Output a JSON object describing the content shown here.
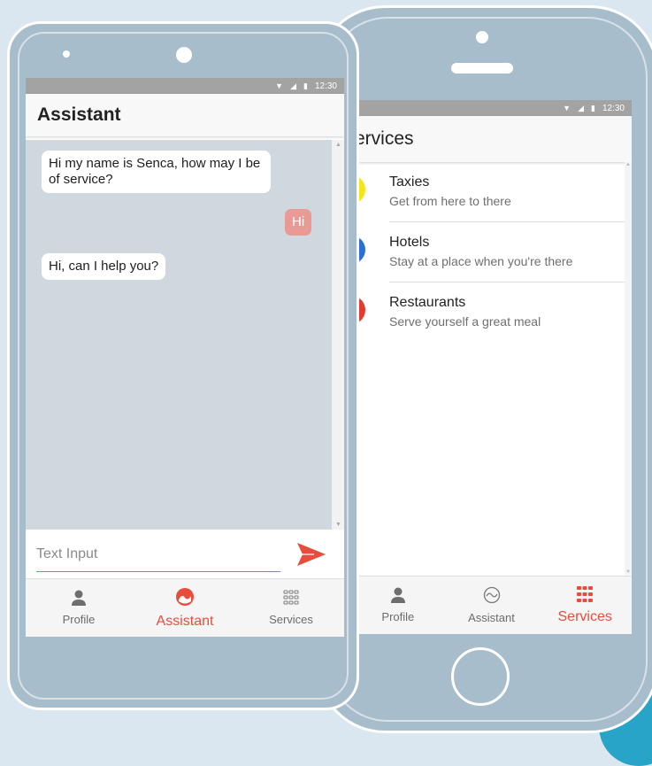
{
  "colors": {
    "accent": "#e84c3d",
    "chat_background": "#d0d8df",
    "user_bubble": "#ea9a94",
    "taxi_icon": "#f5e518",
    "hotel_icon": "#2c6fd6",
    "restaurant_icon": "#e33b2e"
  },
  "status_bar": {
    "time": "12:30"
  },
  "assistant_screen": {
    "title": "Assistant",
    "messages": [
      {
        "from": "bot",
        "text": "Hi my name is Senca, how may I be of service?"
      },
      {
        "from": "user",
        "text": "Hi"
      },
      {
        "from": "bot",
        "text": "Hi, can I help you?"
      }
    ],
    "input": {
      "placeholder": "Text Input",
      "value": ""
    },
    "send_icon": "send-arrow-icon",
    "nav": [
      {
        "label": "Profile",
        "icon": "person-icon",
        "active": false
      },
      {
        "label": "Assistant",
        "icon": "assistant-icon",
        "active": true
      },
      {
        "label": "Services",
        "icon": "grid-icon",
        "active": false
      }
    ]
  },
  "services_screen": {
    "title": "ervices",
    "items": [
      {
        "title": "Taxies",
        "subtitle": "Get from here to there",
        "icon": "taxi-icon"
      },
      {
        "title": "Hotels",
        "subtitle": "Stay at a place when you're there",
        "icon": "hotel-icon"
      },
      {
        "title": "Restaurants",
        "subtitle": "Serve yourself a great meal",
        "icon": "restaurant-icon"
      }
    ],
    "nav": [
      {
        "label": "Profile",
        "icon": "person-icon",
        "active": false
      },
      {
        "label": "Assistant",
        "icon": "assistant-icon",
        "active": false
      },
      {
        "label": "Services",
        "icon": "grid-icon",
        "active": true
      }
    ]
  }
}
